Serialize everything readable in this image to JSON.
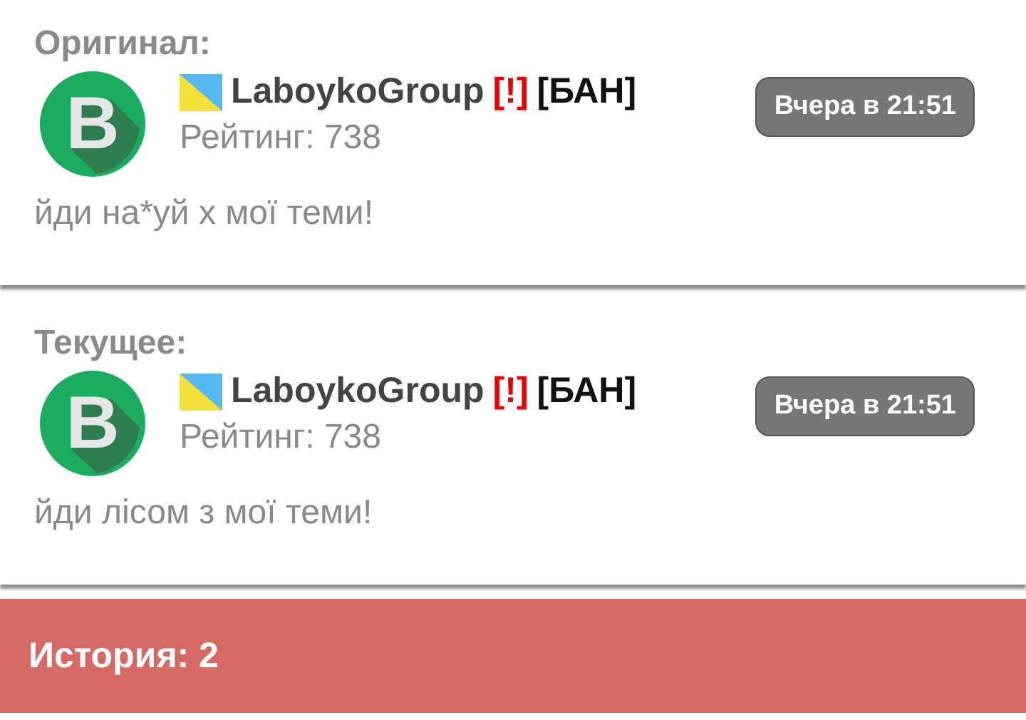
{
  "posts": [
    {
      "heading": "Оригинал:",
      "avatar_letter": "B",
      "author": "LaboykoGroup",
      "warning": "[!]",
      "ban": "[БАН]",
      "rating": "Рейтинг: 738",
      "time": "Вчера в 21:51",
      "text": "йди на*уй х мої теми!"
    },
    {
      "heading": "Текущее:",
      "avatar_letter": "B",
      "author": "LaboykoGroup",
      "warning": "[!]",
      "ban": "[БАН]",
      "rating": "Рейтинг: 738",
      "time": "Вчера в 21:51",
      "text": "йди лісом з мої теми!"
    }
  ],
  "history": {
    "label": "История: 2"
  }
}
